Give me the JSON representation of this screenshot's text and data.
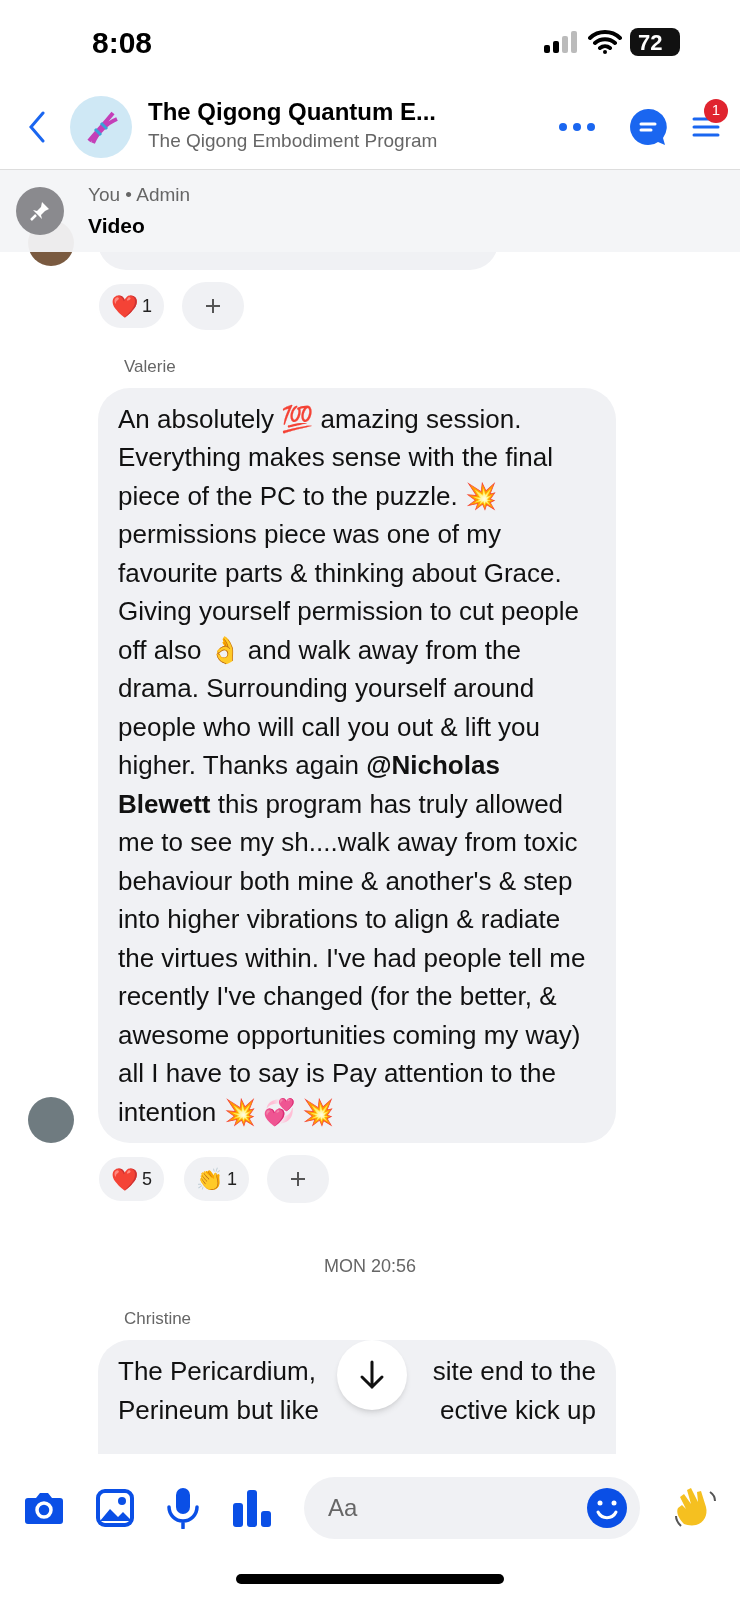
{
  "status_bar": {
    "time": "8:08",
    "battery": "72"
  },
  "header": {
    "title": "The Qigong Quantum E...",
    "subtitle": "The Qigong Embodiment Program",
    "badge": "1"
  },
  "pinned": {
    "meta": "You • Admin",
    "title": "Video"
  },
  "messages": [
    {
      "kind": "hidden",
      "reactions": [
        {
          "emoji": "❤️",
          "count": "1"
        }
      ]
    },
    {
      "kind": "text",
      "sender": "Valerie",
      "text": "An absolutely 💯 amazing session. Everything makes sense with the final piece of the PC to the puzzle. 💥 permissions piece was one of my favourite parts & thinking about Grace. Giving yourself permission to cut people off also 👌 and walk away from the drama. Surrounding yourself around people who will call you out & lift you higher. Thanks again **@Nicholas Blewett**  this program has truly allowed me to see my sh....walk away from toxic behaviour both mine & another's & step into higher vibrations to align & radiate the virtues within. I've had people tell me recently I've changed (for the better, & awesome opportunities coming my way) all I have to say is Pay attention to the intention 💥 💞 💥",
      "reactions": [
        {
          "emoji": "❤️",
          "count": "5"
        },
        {
          "emoji": "👏",
          "count": "1"
        }
      ]
    },
    {
      "kind": "timestamp",
      "text": "MON 20:56"
    },
    {
      "kind": "partial",
      "sender": "Christine",
      "lines": [
        {
          "left": "The Pericardium,",
          "right": "site end to the"
        },
        {
          "left": "Perineum but like",
          "right": "ective kick up"
        }
      ]
    }
  ],
  "composer": {
    "placeholder": "Aa"
  }
}
